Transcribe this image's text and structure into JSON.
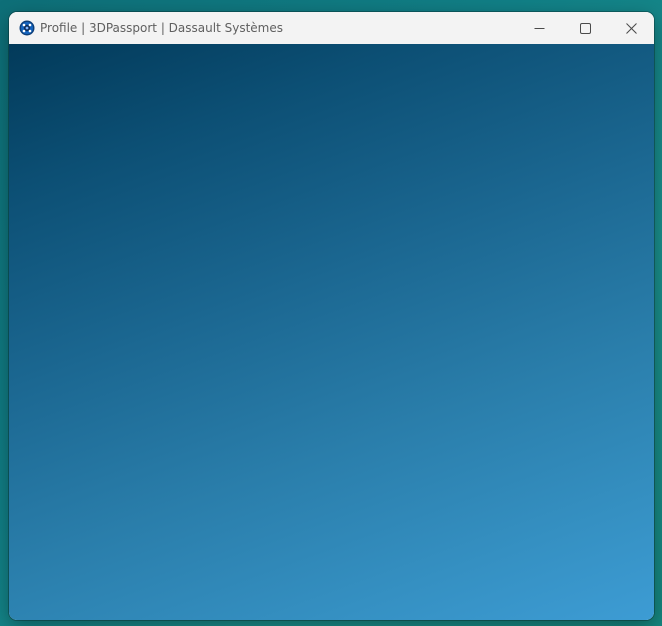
{
  "window": {
    "title": "Profile | 3DPassport | Dassault Systèmes",
    "app_icon": "3dexperience-compass-icon",
    "controls": {
      "minimize_icon": "minimize-icon",
      "maximize_icon": "maximize-icon",
      "close_icon": "close-icon"
    }
  },
  "colors": {
    "titlebar_bg": "#f3f3f3",
    "title_text": "#5f5f5f",
    "content_gradient_start": "#023a5a",
    "content_gradient_end": "#3d9cd4",
    "desktop_bg": "#117f86",
    "app_icon_blue": "#1565c0"
  }
}
